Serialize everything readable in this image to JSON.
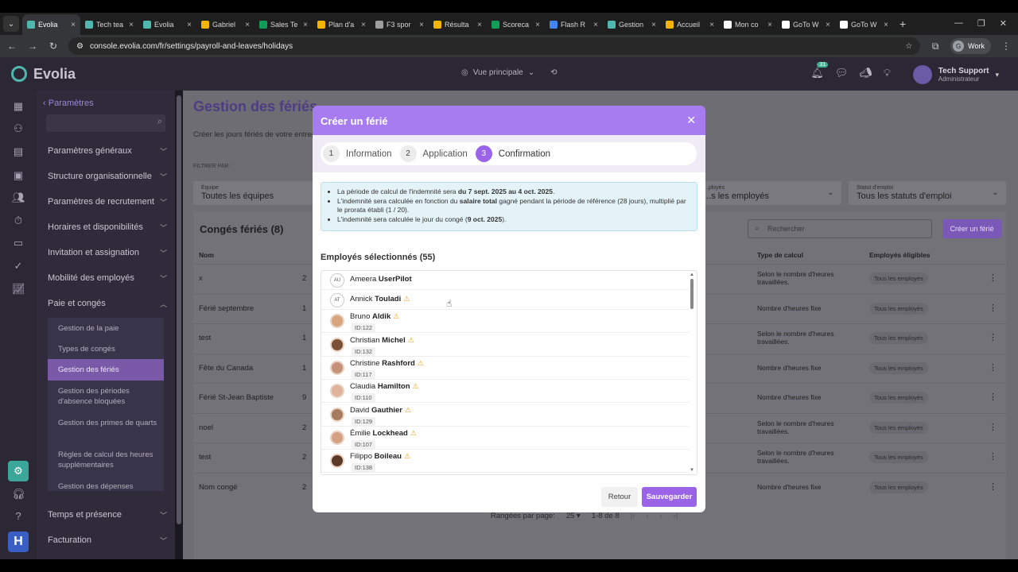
{
  "browser": {
    "tabs": [
      {
        "label": "Evolia",
        "color": "#4fb7ae",
        "active": true
      },
      {
        "label": "Tech tea",
        "color": "#4fb7ae"
      },
      {
        "label": "Evolia",
        "color": "#4fb7ae"
      },
      {
        "label": "Gabriel",
        "color": "#f4b400"
      },
      {
        "label": "Sales Te",
        "color": "#0f9d58"
      },
      {
        "label": "Plan d'a",
        "color": "#f4b400"
      },
      {
        "label": "F3 spor",
        "color": "#9e9e9e"
      },
      {
        "label": "Résulta",
        "color": "#f4b400"
      },
      {
        "label": "Scoreca",
        "color": "#0f9d58"
      },
      {
        "label": "Flash R",
        "color": "#4285f4"
      },
      {
        "label": "Gestion",
        "color": "#4fb7ae"
      },
      {
        "label": "Accueil",
        "color": "#f4b400"
      },
      {
        "label": "Mon co",
        "color": "#ffffff"
      },
      {
        "label": "GoTo W",
        "color": "#ffffff"
      },
      {
        "label": "GoTo W",
        "color": "#ffffff"
      }
    ],
    "url": "console.evolia.com/fr/settings/payroll-and-leaves/holidays",
    "profile_initial": "G",
    "profile_label": "Work"
  },
  "header": {
    "brand": "Evolia",
    "view": "Vue principale",
    "notif_count": "31",
    "user_name": "Tech Support",
    "user_role": "Administrateur"
  },
  "sidebar": {
    "back": "Paramètres",
    "sections": [
      "Paramètres généraux",
      "Structure organisationnelle",
      "Paramètres de recrutement",
      "Horaires et disponibilités",
      "Invitation et assignation",
      "Mobilité des employés",
      "Paie et congés"
    ],
    "sub": [
      "Gestion de la paie",
      "Types de congés",
      "Gestion des fériés",
      "Gestion des périodes d'absence bloquées",
      "Gestion des primes de quarts",
      "Règles de calcul des heures supplémentaires",
      "Gestion des dépenses"
    ],
    "after": [
      "Temps et présence",
      "Facturation"
    ]
  },
  "page": {
    "title": "Gestion des fériés",
    "desc": "Créer les jours fériés de votre entreprise",
    "filter_by": "FILTRER PAR :",
    "filters": [
      {
        "label": "Équipe",
        "value": "Toutes les équipes"
      },
      {
        "label": "...ployés",
        "value": "...s les employés"
      },
      {
        "label": "Statut d'emploi",
        "value": "Tous les statuts d'emploi"
      }
    ],
    "list_title": "Congés fériés (8)",
    "search_placeholder": "Rechercher",
    "add_label": "Créer un férié",
    "cols": {
      "name": "Nom",
      "calc": "Type de calcul",
      "elig": "Employés éligibles"
    },
    "rows": [
      {
        "name": "x",
        "c": "2",
        "calc": "Selon le nombre d'heures travaillées.",
        "elig": "Tous les employés"
      },
      {
        "name": "Férié septembre",
        "c": "1",
        "calc": "Nombre d'heures fixe",
        "elig": "Tous les employés"
      },
      {
        "name": "test",
        "c": "1",
        "calc": "Selon le nombre d'heures travaillées.",
        "elig": "Tous les employés"
      },
      {
        "name": "Fête du Canada",
        "c": "1",
        "calc": "Nombre d'heures fixe",
        "elig": "Tous les employés"
      },
      {
        "name": "Férié St-Jean Baptiste",
        "c": "9",
        "calc": "Nombre d'heures fixe",
        "elig": "Tous les employés"
      },
      {
        "name": "noel",
        "c": "2",
        "calc": "Selon le nombre d'heures travaillées.",
        "elig": "Tous les employés"
      },
      {
        "name": "test",
        "c": "2",
        "calc": "Selon le nombre d'heures travaillées.",
        "elig": "Tous les employés"
      },
      {
        "name": "Nom congé",
        "c": "2",
        "calc": "Nombre d'heures fixe",
        "elig": "Tous les employés"
      }
    ],
    "rows_per_page_label": "Rangées par page:",
    "rows_per_page": "25",
    "range": "1-8 de 8"
  },
  "modal": {
    "title": "Créer un férié",
    "steps": [
      {
        "n": "1",
        "label": "Information"
      },
      {
        "n": "2",
        "label": "Application"
      },
      {
        "n": "3",
        "label": "Confirmation"
      }
    ],
    "info": [
      {
        "pre": "La période de calcul de l'indemnité sera ",
        "b": "du 7 sept. 2025 au 4 oct. 2025",
        "post": "."
      },
      {
        "pre": "L'indemnité sera calculée en fonction du ",
        "b": "salaire total",
        "post": " gagné pendant la période de référence (28 jours), multiplié par le prorata établi (1 / 20)."
      },
      {
        "pre": "L'indemnité sera calculée le jour du congé (",
        "b": "9 oct. 2025",
        "post": ")."
      }
    ],
    "selected_title": "Employés sélectionnés (55)",
    "employees": [
      {
        "first": "Ameera",
        "last": "UserPilot",
        "init": "AU",
        "id": "",
        "warn": false
      },
      {
        "first": "Annick",
        "last": "Touladi",
        "init": "AT",
        "id": "",
        "warn": true
      },
      {
        "first": "Bruno",
        "last": "Aldik",
        "init": "",
        "id": "ID:122",
        "warn": true
      },
      {
        "first": "Christian",
        "last": "Michel",
        "init": "",
        "id": "ID:132",
        "warn": true
      },
      {
        "first": "Christine",
        "last": "Rashford",
        "init": "",
        "id": "ID:117",
        "warn": true
      },
      {
        "first": "Claudia",
        "last": "Hamilton",
        "init": "",
        "id": "ID:110",
        "warn": true
      },
      {
        "first": "David",
        "last": "Gauthier",
        "init": "",
        "id": "ID:129",
        "warn": true
      },
      {
        "first": "Émilie",
        "last": "Lockhead",
        "init": "",
        "id": "ID:107",
        "warn": true
      },
      {
        "first": "Filippo",
        "last": "Boileau",
        "init": "",
        "id": "ID:138",
        "warn": true
      }
    ],
    "back_label": "Retour",
    "save_label": "Sauvegarder"
  }
}
